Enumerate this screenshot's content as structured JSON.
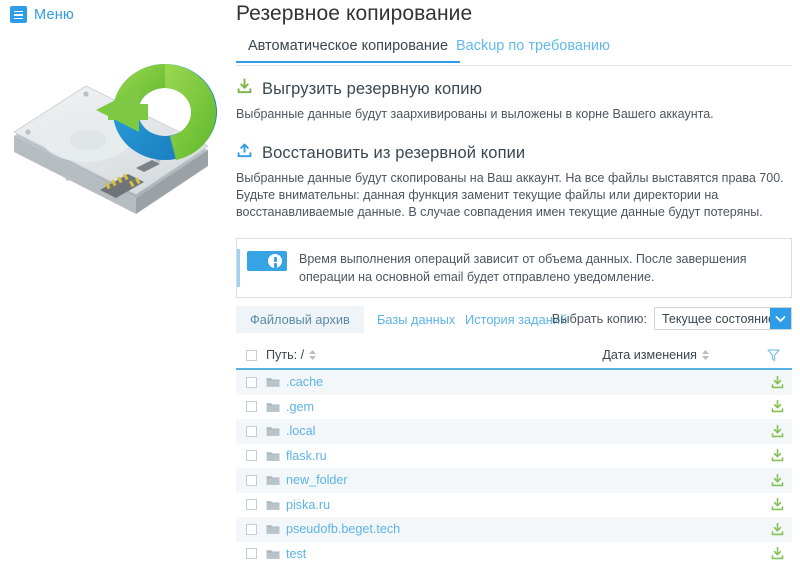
{
  "sidebar": {
    "menu_label": "Меню",
    "illustration_name": "hdd-backup-illustration"
  },
  "header": {
    "title": "Резервное копирование"
  },
  "tabs": [
    {
      "label": "Автоматическое копирование",
      "active": true
    },
    {
      "label": "Backup по требованию",
      "active": false
    }
  ],
  "sections": [
    {
      "icon": "download-icon",
      "title": "Выгрузить резервную копию",
      "body": "Выбранные данные будут заархивированы и выложены в корне Вашего аккаунта."
    },
    {
      "icon": "upload-icon",
      "title": "Восстановить из резервной копии",
      "body": "Выбранные данные будут скопированы на Ваш аккаунт. На все файлы выставятся права 700.\nБудьте внимательны: данная функция заменит текущие файлы или директории на восстанавливаемые данные. В случае совпадения имен текущие данные будут потеряны."
    }
  ],
  "notice": {
    "icon": "info-icon",
    "text": "Время выполнения операций зависит от объема данных. После завершения операции на основной email будет отправлено уведомление."
  },
  "subtabs": [
    {
      "label": "Файловый архив",
      "active": true
    },
    {
      "label": "Базы данных",
      "active": false
    },
    {
      "label": "История заданий",
      "active": false
    }
  ],
  "copy_select": {
    "label": "Выбрать копию:",
    "value": "Текущее состояние",
    "arrow_icon": "chevron-down-icon"
  },
  "table": {
    "select_all_checkbox": "",
    "columns": [
      {
        "label": "Путь: /",
        "sort_icon": "sort-arrows-icon"
      },
      {
        "label": "Дата изменения",
        "sort_icon": "sort-arrows-icon"
      }
    ],
    "filter_icon": "funnel-filter-icon",
    "row_download_icon": "download-icon",
    "rows": [
      {
        "name": ".cache",
        "date": "",
        "icon": "folder-icon"
      },
      {
        "name": ".gem",
        "date": "",
        "icon": "folder-icon"
      },
      {
        "name": ".local",
        "date": "",
        "icon": "folder-icon"
      },
      {
        "name": "flask.ru",
        "date": "",
        "icon": "folder-icon"
      },
      {
        "name": "new_folder",
        "date": "",
        "icon": "folder-icon"
      },
      {
        "name": "piska.ru",
        "date": "",
        "icon": "folder-icon"
      },
      {
        "name": "pseudofb.beget.tech",
        "date": "",
        "icon": "folder-icon"
      },
      {
        "name": "test",
        "date": "",
        "icon": "folder-icon"
      }
    ]
  },
  "colors": {
    "accent_blue": "#2e9ce8",
    "link_blue": "#5cb3e8",
    "green": "#7cb342",
    "text_dark": "#3a4750",
    "row_alt": "#f4f7f9",
    "table_rule": "#55b4e4"
  }
}
